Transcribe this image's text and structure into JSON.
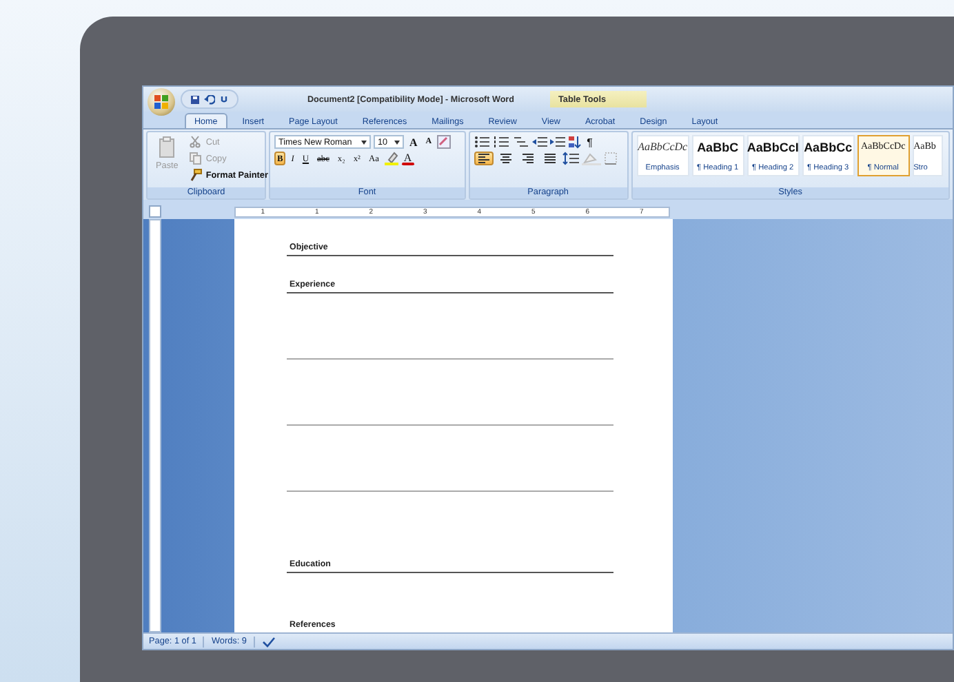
{
  "window": {
    "title": "Document2 [Compatibility Mode] - Microsoft Word",
    "context_title": "Table Tools"
  },
  "tabs": [
    {
      "label": "Home",
      "selected": true
    },
    {
      "label": "Insert",
      "selected": false
    },
    {
      "label": "Page Layout",
      "selected": false
    },
    {
      "label": "References",
      "selected": false
    },
    {
      "label": "Mailings",
      "selected": false
    },
    {
      "label": "Review",
      "selected": false
    },
    {
      "label": "View",
      "selected": false
    },
    {
      "label": "Acrobat",
      "selected": false
    },
    {
      "label": "Design",
      "selected": false
    },
    {
      "label": "Layout",
      "selected": false
    }
  ],
  "clipboard": {
    "label": "Clipboard",
    "paste": {
      "label": "Paste",
      "disabled": true
    },
    "items": [
      {
        "kind": "cut",
        "label": "Cut",
        "disabled": true
      },
      {
        "kind": "copy",
        "label": "Copy",
        "disabled": true
      },
      {
        "kind": "painter",
        "label": "Format Painter",
        "disabled": false
      }
    ]
  },
  "font": {
    "label": "Font",
    "font_name": "Times New Roman",
    "font_size": "10",
    "size_buttons": [
      "A",
      "A"
    ],
    "format_buttons": [
      {
        "label": "B",
        "selected": true
      },
      {
        "label": "I",
        "selected": false
      },
      {
        "label": "U",
        "selected": false
      },
      {
        "label": "abc",
        "selected": false
      },
      {
        "label": "x₂",
        "selected": false
      },
      {
        "label": "x²",
        "selected": false
      },
      {
        "label": "Aa",
        "selected": false
      }
    ],
    "font_color": "A"
  },
  "paragraph": {
    "label": "Paragraph",
    "pilcrow": "¶",
    "alignments": [
      {
        "kind": "left",
        "selected": true
      },
      {
        "kind": "center",
        "selected": false
      },
      {
        "kind": "right",
        "selected": false
      },
      {
        "kind": "justify",
        "selected": false
      }
    ]
  },
  "styles": {
    "label": "Styles",
    "items": [
      {
        "preview": "AaBbCcDc",
        "name": "Emphasis",
        "kind": "italic",
        "selected": false
      },
      {
        "preview": "AaBbC",
        "name": "¶ Heading 1",
        "kind": "heading",
        "selected": false
      },
      {
        "preview": "AaBbCcI",
        "name": "¶ Heading 2",
        "kind": "heading",
        "selected": false
      },
      {
        "preview": "AaBbCc",
        "name": "¶ Heading 3",
        "kind": "heading",
        "selected": false
      },
      {
        "preview": "AaBbCcDc",
        "name": "¶ Normal",
        "kind": "normal",
        "selected": true
      },
      {
        "preview": "AaBb",
        "name": "Stro",
        "kind": "normal",
        "selected": false
      }
    ]
  },
  "ruler": [
    "1",
    "1",
    "2",
    "3",
    "4",
    "5",
    "6",
    "7"
  ],
  "document": [
    {
      "kind": "heading",
      "text": "Objective"
    },
    {
      "kind": "heading",
      "text": "Experience"
    },
    {
      "kind": "blank"
    },
    {
      "kind": "blank"
    },
    {
      "kind": "blank"
    },
    {
      "kind": "heading",
      "text": "Education"
    },
    {
      "kind": "heading",
      "text": "References"
    }
  ],
  "status_bar": {
    "page": "Page: 1 of 1",
    "words": "Words: 9"
  }
}
